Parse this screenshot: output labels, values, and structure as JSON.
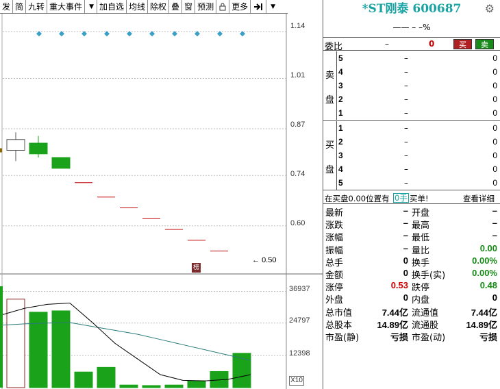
{
  "toolbar": {
    "items": [
      "发",
      "简",
      "九转",
      "重大事件",
      "加自选",
      "均线",
      "除权",
      "叠",
      "窗",
      "预测",
      "更多"
    ],
    "colors": {
      "up": "#c00000",
      "down": "#1aa31a",
      "ma": "#000000",
      "ma2": "#2a7a7a"
    }
  },
  "chart": {
    "price_labels": [
      "1.14",
      "1.01",
      "0.87",
      "0.74",
      "0.60"
    ],
    "low_marker": "0.50",
    "volume_labels": [
      "36937",
      "24797",
      "12398"
    ],
    "scale_label": "X10",
    "event_tag": "榜"
  },
  "chart_data": {
    "type": "candlestick",
    "ylim": [
      0.47,
      1.19
    ],
    "limit_up_markers": [
      1.14,
      1.14,
      1.14,
      1.14,
      1.14,
      1.14,
      1.14,
      1.14,
      1.14,
      1.14
    ],
    "candles": [
      {
        "open": 0.81,
        "close": 0.84,
        "high": 0.86,
        "low": 0.78
      },
      {
        "open": 0.83,
        "close": 0.8,
        "high": 0.85,
        "low": 0.79
      },
      {
        "open": 0.79,
        "close": 0.76,
        "high": 0.79,
        "low": 0.76
      },
      {
        "open": 0.72,
        "close": 0.72,
        "high": 0.72,
        "low": 0.72
      },
      {
        "open": 0.68,
        "close": 0.68,
        "high": 0.68,
        "low": 0.68
      },
      {
        "open": 0.65,
        "close": 0.65,
        "high": 0.65,
        "low": 0.65
      },
      {
        "open": 0.62,
        "close": 0.62,
        "high": 0.62,
        "low": 0.62
      },
      {
        "open": 0.59,
        "close": 0.59,
        "high": 0.59,
        "low": 0.59
      },
      {
        "open": 0.56,
        "close": 0.56,
        "high": 0.56,
        "low": 0.56
      },
      {
        "open": 0.53,
        "close": 0.53,
        "high": 0.53,
        "low": 0.53
      }
    ],
    "volume": {
      "ylim": [
        0,
        40000
      ],
      "values": [
        34000,
        29000,
        29500,
        6000,
        7800,
        1000,
        800,
        1000,
        2600,
        6200,
        13200
      ],
      "up": [
        true,
        false,
        false,
        false,
        false,
        false,
        false,
        false,
        false,
        false,
        false
      ],
      "ma5": [
        28000,
        30500,
        32000,
        32500,
        25000,
        17000,
        11000,
        5000,
        2800,
        2600,
        3200,
        5000
      ],
      "ma10": [
        24000,
        24500,
        24800,
        25000,
        23500,
        22000,
        20500,
        18500,
        16500,
        14500,
        12500,
        10500
      ]
    }
  },
  "panel": {
    "title": "*ST刚泰 600687",
    "change": "——  –  –%",
    "wb_label": "委比",
    "wb_value": "–",
    "wb_num": "0",
    "buy": "买",
    "sell": "卖",
    "sell_side": [
      "卖",
      "盘"
    ],
    "buy_side": [
      "买",
      "盘"
    ],
    "sell_rows": [
      {
        "level": "5",
        "price": "–",
        "vol": "0"
      },
      {
        "level": "4",
        "price": "–",
        "vol": "0"
      },
      {
        "level": "3",
        "price": "–",
        "vol": "0"
      },
      {
        "level": "2",
        "price": "–",
        "vol": "0"
      },
      {
        "level": "1",
        "price": "–",
        "vol": "0"
      }
    ],
    "buy_rows": [
      {
        "level": "1",
        "price": "–",
        "vol": "0"
      },
      {
        "level": "2",
        "price": "–",
        "vol": "0"
      },
      {
        "level": "3",
        "price": "–",
        "vol": "0"
      },
      {
        "level": "4",
        "price": "–",
        "vol": "0"
      },
      {
        "level": "5",
        "price": "–",
        "vol": "0"
      }
    ],
    "mid": {
      "left": "在买盘0.00位置有",
      "hand": "0手",
      "right": "买单!",
      "detail": "查看详细"
    },
    "quotes": [
      {
        "l1": "最新",
        "v1": "–",
        "l2": "开盘",
        "v2": "–"
      },
      {
        "l1": "涨跌",
        "v1": "–",
        "l2": "最高",
        "v2": "–"
      },
      {
        "l1": "涨幅",
        "v1": "–",
        "l2": "最低",
        "v2": "–"
      },
      {
        "l1": "振幅",
        "v1": "–",
        "l2": "量比",
        "v2": "0.00"
      },
      {
        "l1": "总手",
        "v1": "0",
        "l2": "换手",
        "v2": "0.00%"
      },
      {
        "l1": "金额",
        "v1": "0",
        "l2": "换手(实)",
        "v2": "0.00%"
      },
      {
        "l1": "涨停",
        "v1": "0.53",
        "l2": "跌停",
        "v2": "0.48"
      },
      {
        "l1": "外盘",
        "v1": "0",
        "l2": "内盘",
        "v2": "0"
      },
      {
        "l1": "总市值",
        "v1": "7.44亿",
        "l2": "流通值",
        "v2": "7.44亿"
      },
      {
        "l1": "总股本",
        "v1": "14.89亿",
        "l2": "流通股",
        "v2": "14.89亿"
      },
      {
        "l1": "市盈(静)",
        "v1": "亏损",
        "l2": "市盈(动)",
        "v2": "亏损"
      }
    ]
  }
}
